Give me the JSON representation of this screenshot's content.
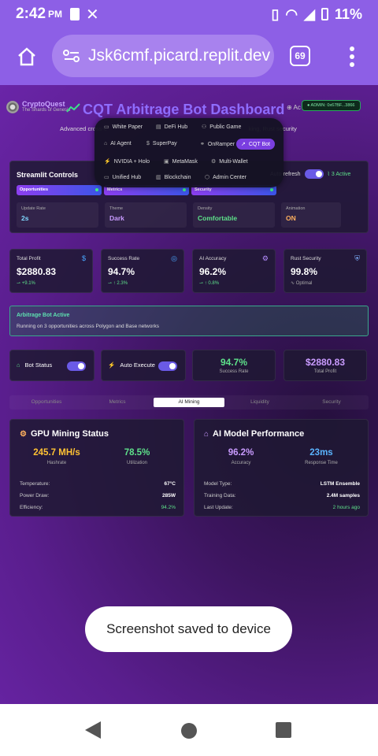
{
  "status_bar": {
    "time": "2:42",
    "ampm": "PM",
    "battery": "11%"
  },
  "browser": {
    "url": "Jsk6cmf.picard.replit.dev",
    "tab_count": "69"
  },
  "app": {
    "brand": "CryptoQuest",
    "brand_sub": "The Shards of Genesis",
    "title": "CQT Arbitrage Bot Dashboard",
    "admin_badge": "ADMIN: 0x67BF...3866",
    "subtitle_left": "Advanced cross-c",
    "subtitle_right": "king, Rust security"
  },
  "nav_menu": {
    "items": [
      {
        "label": "White Paper",
        "icon": "book-icon"
      },
      {
        "label": "DeFi Hub",
        "icon": "chart-icon"
      },
      {
        "label": "Public Game",
        "icon": "users-icon"
      },
      {
        "label": "AI Agent",
        "icon": "bot-icon"
      },
      {
        "label": "SuperPay",
        "icon": "dollar-icon"
      },
      {
        "label": "OnRamper",
        "icon": "cart-icon"
      },
      {
        "label": "CQT Bot",
        "icon": "trend-icon",
        "active": true
      },
      {
        "label": "NVIDIA + Holo",
        "icon": "zap-icon"
      },
      {
        "label": "MetaMask",
        "icon": "wallet-icon"
      },
      {
        "label": "Multi-Wallet",
        "icon": "gear-icon"
      },
      {
        "label": "Unified Hub",
        "icon": "book-icon"
      },
      {
        "label": "Blockchain",
        "icon": "database-icon"
      },
      {
        "label": "Admin Center",
        "icon": "shield-icon"
      }
    ]
  },
  "controls": {
    "title": "Streamlit Controls",
    "autorefresh_label": "Auto-refresh",
    "active_count": "3 Active",
    "chips": [
      "Opportunities",
      "Metrics",
      "Security"
    ],
    "fields": [
      {
        "label": "Update Rate",
        "value": "2s",
        "color": "#7fd8ff"
      },
      {
        "label": "Theme",
        "value": "Dark",
        "color": "#c99bff"
      },
      {
        "label": "Density",
        "value": "Comfortable",
        "color": "#5ee08a"
      },
      {
        "label": "Animation",
        "value": "ON",
        "color": "#ffb05e"
      }
    ]
  },
  "metrics": [
    {
      "label": "Total Profit",
      "value": "$2880.83",
      "delta": "+9.1%",
      "icon": "$",
      "icon_color": "#4aa8ff"
    },
    {
      "label": "Success Rate",
      "value": "94.7%",
      "delta": "↑ 2.3%",
      "icon": "◎",
      "icon_color": "#4aa8ff"
    },
    {
      "label": "AI Accuracy",
      "value": "96.2%",
      "delta": "↑ 0.8%",
      "icon": "⚙",
      "icon_color": "#b48cff"
    },
    {
      "label": "Rust Security",
      "value": "99.8%",
      "delta": "Optimal",
      "icon": "⛨",
      "icon_color": "#7fb0ff"
    }
  ],
  "alert": {
    "title": "Arbitrage Bot Active",
    "body": "Running on 3 opportunities across Polygon and Base networks"
  },
  "bot_controls": [
    {
      "label": "Bot Status",
      "icon": "⌂",
      "icon_color": "#5ee08a"
    },
    {
      "label": "Auto Execute",
      "icon": "⚡",
      "icon_color": "#ffb05e"
    }
  ],
  "stats": [
    {
      "value": "94.7%",
      "label": "Success Rate",
      "color": "#5ee08a"
    },
    {
      "value": "$2880.83",
      "label": "Total Profit",
      "color": "#c99bff"
    }
  ],
  "tabs": [
    "Opportunities",
    "Metrics",
    "AI Mining",
    "Liquidity",
    "Security"
  ],
  "gpu": {
    "title": "GPU Mining Status",
    "hashrate": "245.7 MH/s",
    "hashrate_label": "Hashrate",
    "util": "78.5%",
    "util_label": "Utilization",
    "rows": [
      {
        "label": "Temperature:",
        "value": "67°C",
        "color": "#ffffff"
      },
      {
        "label": "Power Draw:",
        "value": "285W",
        "color": "#ffffff"
      },
      {
        "label": "Efficiency:",
        "value": "94.2%",
        "color": "#5ee08a"
      }
    ]
  },
  "ai_model": {
    "title": "AI Model Performance",
    "accuracy": "96.2%",
    "accuracy_label": "Accuracy",
    "response": "23ms",
    "response_label": "Response Time",
    "rows": [
      {
        "label": "Model Type:",
        "value": "LSTM Ensemble",
        "color": "#ffffff"
      },
      {
        "label": "Training Data:",
        "value": "2.4M samples",
        "color": "#ffffff"
      },
      {
        "label": "Last Update:",
        "value": "2 hours ago",
        "color": "#5ee08a"
      }
    ]
  },
  "toast": "Screenshot saved to device"
}
